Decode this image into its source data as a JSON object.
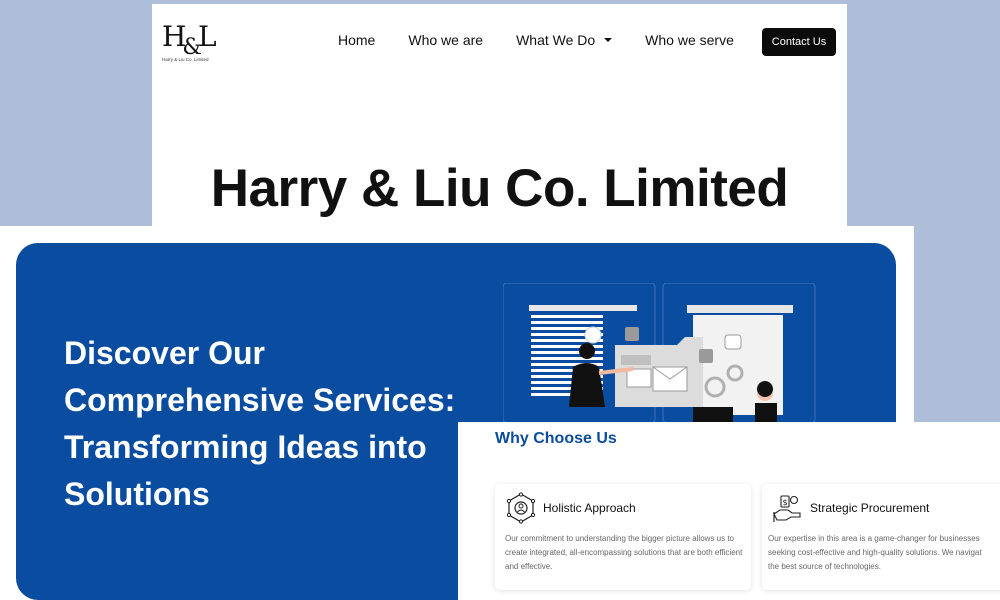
{
  "header": {
    "logo_mark_h": "H",
    "logo_mark_amp": "&",
    "logo_mark_l": "L",
    "logo_subtitle": "Harry & Liu Co. Limited",
    "nav": {
      "home": "Home",
      "who_we_are": "Who we are",
      "what_we_do": "What We Do",
      "who_we_serve": "Who we serve"
    },
    "contact_label": "Contact Us"
  },
  "hero_title": "Harry & Liu Co. Limited",
  "services": {
    "heading": "Discover Our Comprehensive Services: Transforming Ideas into Solutions"
  },
  "why": {
    "title": "Why Choose Us",
    "cards": [
      {
        "title": "Holistic Approach",
        "text": "Our commitment to understanding the bigger picture allows us to create integrated, all-encompassing solutions that are both efficient and effective.",
        "icon": "network-person-icon"
      },
      {
        "title": "Strategic Procurement",
        "text_line1": "Our expertise in this area is a game-changer for businesses",
        "text_line2": "seeking cost-effective and high-quality solutions. We navigat",
        "text_line3": "the best source of technologies.",
        "icon": "handshake-money-icon"
      }
    ]
  },
  "colors": {
    "brand_blue": "#0a4da0",
    "background": "#aebed8",
    "button_black": "#0b0b0b"
  }
}
